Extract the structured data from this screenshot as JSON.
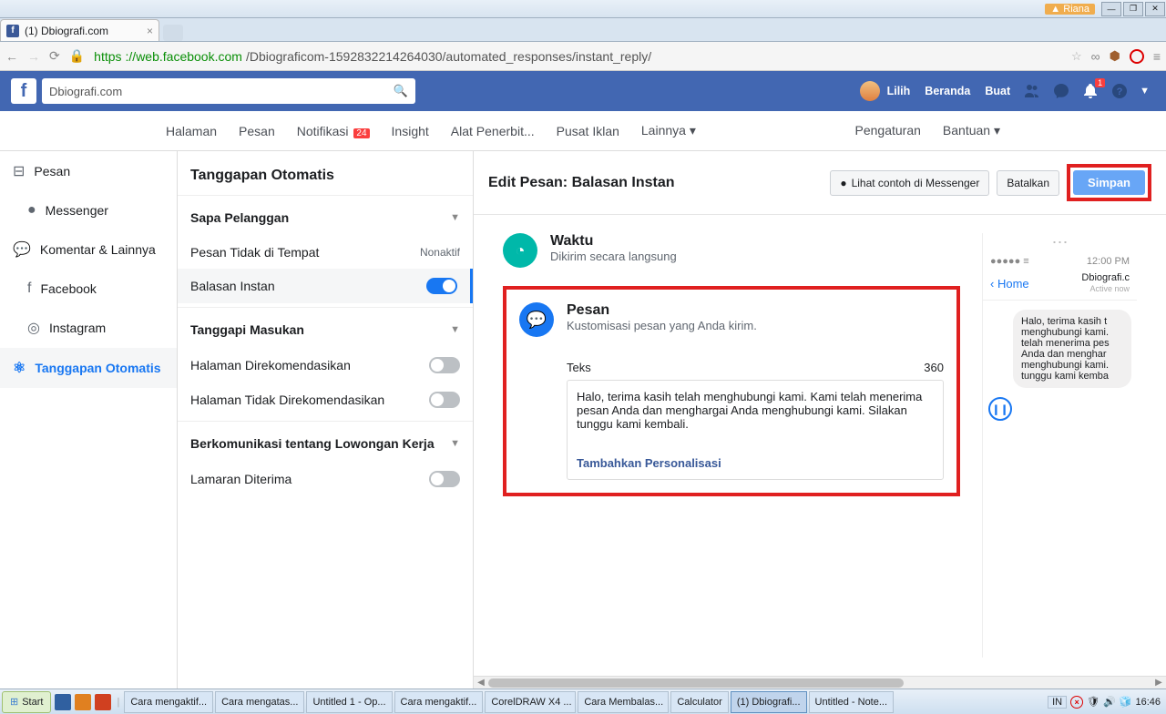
{
  "os": {
    "user": "Riana",
    "taskbar": {
      "start": "Start",
      "items": [
        "Cara mengaktif...",
        "Cara mengatas...",
        "Untitled 1 - Op...",
        "Cara mengaktif...",
        "CorelDRAW X4 ...",
        "Cara Membalas...",
        "Calculator",
        "(1) Dbiografi...",
        "Untitled - Note..."
      ],
      "lang": "IN",
      "clock": "16:46"
    }
  },
  "browser": {
    "tab_title": "(1) Dbiografi.com",
    "url_https": "https",
    "url_domain": "://web.facebook.com",
    "url_path": "/Dbiograficom-1592832214264030/automated_responses/instant_reply/"
  },
  "fb": {
    "search": "Dbiografi.com",
    "links": {
      "lilih": "Lilih",
      "beranda": "Beranda",
      "buat": "Buat"
    },
    "notif_count": "1",
    "nav": {
      "halaman": "Halaman",
      "pesan": "Pesan",
      "notifikasi": "Notifikasi",
      "notif_badge": "24",
      "insight": "Insight",
      "alat": "Alat Penerbit...",
      "iklan": "Pusat Iklan",
      "lainnya": "Lainnya ▾",
      "pengaturan": "Pengaturan",
      "bantuan": "Bantuan ▾"
    }
  },
  "left": {
    "pesan": "Pesan",
    "messenger": "Messenger",
    "komentar": "Komentar & Lainnya",
    "facebook": "Facebook",
    "instagram": "Instagram",
    "otomatis": "Tanggapan Otomatis"
  },
  "mid": {
    "title": "Tanggapan Otomatis",
    "sec1": "Sapa Pelanggan",
    "r1": "Pesan Tidak di Tempat",
    "r1_stat": "Nonaktif",
    "r2": "Balasan Instan",
    "sec2": "Tanggapi Masukan",
    "r3": "Halaman Direkomendasikan",
    "r4": "Halaman Tidak Direkomendasikan",
    "sec3": "Berkomunikasi tentang Lowongan Kerja",
    "r5": "Lamaran Diterima"
  },
  "main": {
    "edit_title": "Edit Pesan: Balasan Instan",
    "lihat": "Lihat contoh di Messenger",
    "batalkan": "Batalkan",
    "simpan": "Simpan",
    "waktu_t": "Waktu",
    "waktu_s": "Dikirim secara langsung",
    "pesan_t": "Pesan",
    "pesan_s": "Kustomisasi pesan yang Anda kirim.",
    "teks_label": "Teks",
    "char_count": "360",
    "teks_body": "Halo, terima kasih telah menghubungi kami. Kami telah menerima pesan Anda dan menghargai Anda menghubungi kami. Silakan tunggu kami kembali.",
    "personalisasi": "Tambahkan Personalisasi"
  },
  "preview": {
    "signal": "●●●●● ⁠≡",
    "time": "12:00 PM",
    "home": "Home",
    "name": "Dbiografi.c",
    "active": "Active now",
    "bubble": "Halo, terima kasih t\nmenghubungi kami.\ntelah menerima pes\nAnda dan menghar\nmenghubungi kami.\ntunggu kami kemba"
  }
}
